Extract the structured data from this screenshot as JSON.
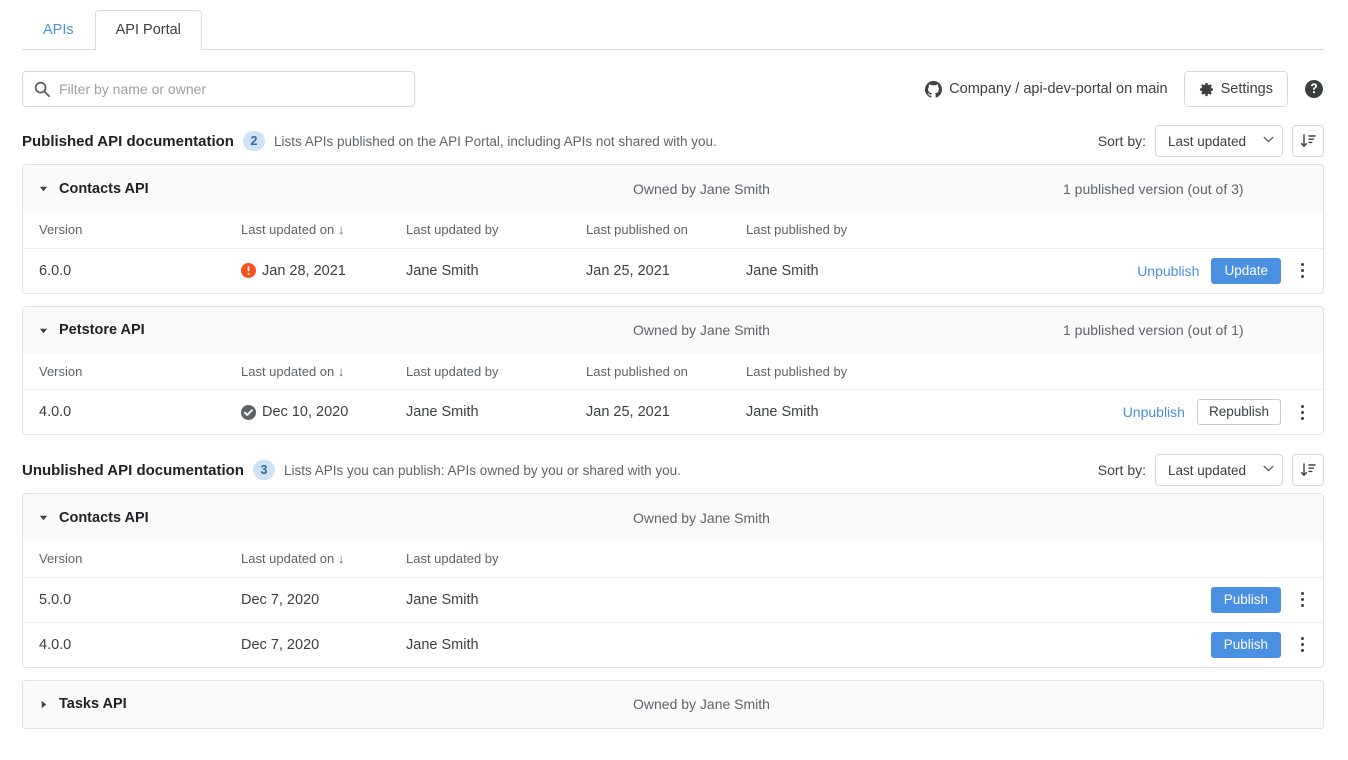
{
  "tabs": [
    {
      "label": "APIs",
      "active": false
    },
    {
      "label": "API Portal",
      "active": true
    }
  ],
  "toolbar": {
    "search_placeholder": "Filter by name or owner",
    "search_value": "",
    "search_icon": "search-icon",
    "repo_icon": "github-icon",
    "repo_text": "Company / api-dev-portal on main",
    "settings_label": "Settings",
    "settings_icon": "gear-icon",
    "help_icon": "help-circle-icon"
  },
  "sections": [
    {
      "id": "published",
      "title": "Published API documentation",
      "count": "2",
      "subtitle": "Lists APIs published on the API Portal, including APIs not shared with you.",
      "sort_label": "Sort by:",
      "sort_value": "Last updated",
      "sort_options": [
        "Last updated"
      ],
      "sort_direction_icon": "sort-descending-icon",
      "columns": [
        "Version",
        "Last updated on ↓",
        "Last updated by",
        "Last published on",
        "Last published by"
      ],
      "cards": [
        {
          "name": "Contacts API",
          "expanded": true,
          "caret": "caret-down-icon",
          "owner": "Owned by Jane Smith",
          "count_text": "1 published version (out of 3)",
          "rows": [
            {
              "version": "6.0.0",
              "status_icon": "warning-icon",
              "last_updated_on": "Jan 28, 2021",
              "last_updated_by": "Jane Smith",
              "last_published_on": "Jan 25, 2021",
              "last_published_by": "Jane Smith",
              "link_action": "Unpublish",
              "button_action": "Update",
              "button_style": "primary",
              "menu_icon": "kebab-menu-icon"
            }
          ]
        },
        {
          "name": "Petstore API",
          "expanded": true,
          "caret": "caret-down-icon",
          "owner": "Owned by Jane Smith",
          "count_text": "1 published version (out of 1)",
          "rows": [
            {
              "version": "4.0.0",
              "status_icon": "check-circle-icon",
              "last_updated_on": "Dec 10, 2020",
              "last_updated_by": "Jane Smith",
              "last_published_on": "Jan 25, 2021",
              "last_published_by": "Jane Smith",
              "link_action": "Unpublish",
              "button_action": "Republish",
              "button_style": "secondary",
              "menu_icon": "kebab-menu-icon"
            }
          ]
        }
      ]
    },
    {
      "id": "unpublished",
      "title": "Unublished API documentation",
      "count": "3",
      "subtitle": "Lists APIs you can publish: APIs owned by you or shared with you.",
      "sort_label": "Sort by:",
      "sort_value": "Last updated",
      "sort_options": [
        "Last updated"
      ],
      "sort_direction_icon": "sort-descending-icon",
      "columns": [
        "Version",
        "Last updated on ↓",
        "Last updated by"
      ],
      "cards": [
        {
          "name": "Contacts API",
          "expanded": true,
          "caret": "caret-down-icon",
          "owner": "Owned by Jane Smith",
          "count_text": "",
          "rows": [
            {
              "version": "5.0.0",
              "status_icon": "",
              "last_updated_on": "Dec 7, 2020",
              "last_updated_by": "Jane Smith",
              "link_action": "",
              "button_action": "Publish",
              "button_style": "primary",
              "menu_icon": "kebab-menu-icon"
            },
            {
              "version": "4.0.0",
              "status_icon": "",
              "last_updated_on": "Dec 7, 2020",
              "last_updated_by": "Jane Smith",
              "link_action": "",
              "button_action": "Publish",
              "button_style": "primary",
              "menu_icon": "kebab-menu-icon"
            }
          ]
        },
        {
          "name": "Tasks API",
          "expanded": false,
          "caret": "caret-right-icon",
          "owner": "Owned by Jane Smith",
          "count_text": "",
          "rows": []
        }
      ]
    }
  ],
  "colors": {
    "accent_blue": "#4a90e2",
    "warning_orange": "#f4511e",
    "status_gray": "#5f6368",
    "badge_bg": "#cfe2f5",
    "badge_text": "#34689e"
  }
}
